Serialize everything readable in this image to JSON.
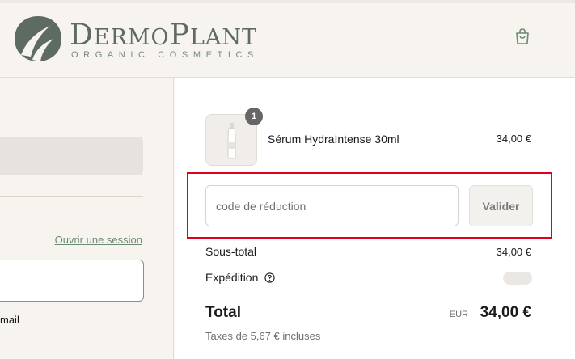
{
  "brand": {
    "name_first_cap": "D",
    "name_first_rest": "ERMO",
    "name_second_cap": "P",
    "name_second_rest": "LANT",
    "tagline": "ORGANIC COSMETICS",
    "icon": "leaf-logo-icon",
    "accent_color": "#5d6b61"
  },
  "header": {
    "cart_icon": "shopping-bag-icon"
  },
  "contact": {
    "login_link": "Ouvrir une session",
    "email_label_partial": "mail",
    "email_value": ""
  },
  "order_summary": {
    "items": [
      {
        "name": "Sérum HydraIntense 30ml",
        "quantity": "1",
        "price": "34,00 €"
      }
    ],
    "discount": {
      "placeholder": "code de réduction",
      "value": "",
      "button_label": "Valider"
    },
    "subtotal_label": "Sous-total",
    "subtotal_value": "34,00 €",
    "shipping_label": "Expédition",
    "shipping_help_icon": "question-circle-icon",
    "total_label": "Total",
    "total_currency": "EUR",
    "total_value": "34,00 €",
    "taxes_note": "Taxes de 5,67 € incluses",
    "highlight_color": "#e0001b"
  }
}
